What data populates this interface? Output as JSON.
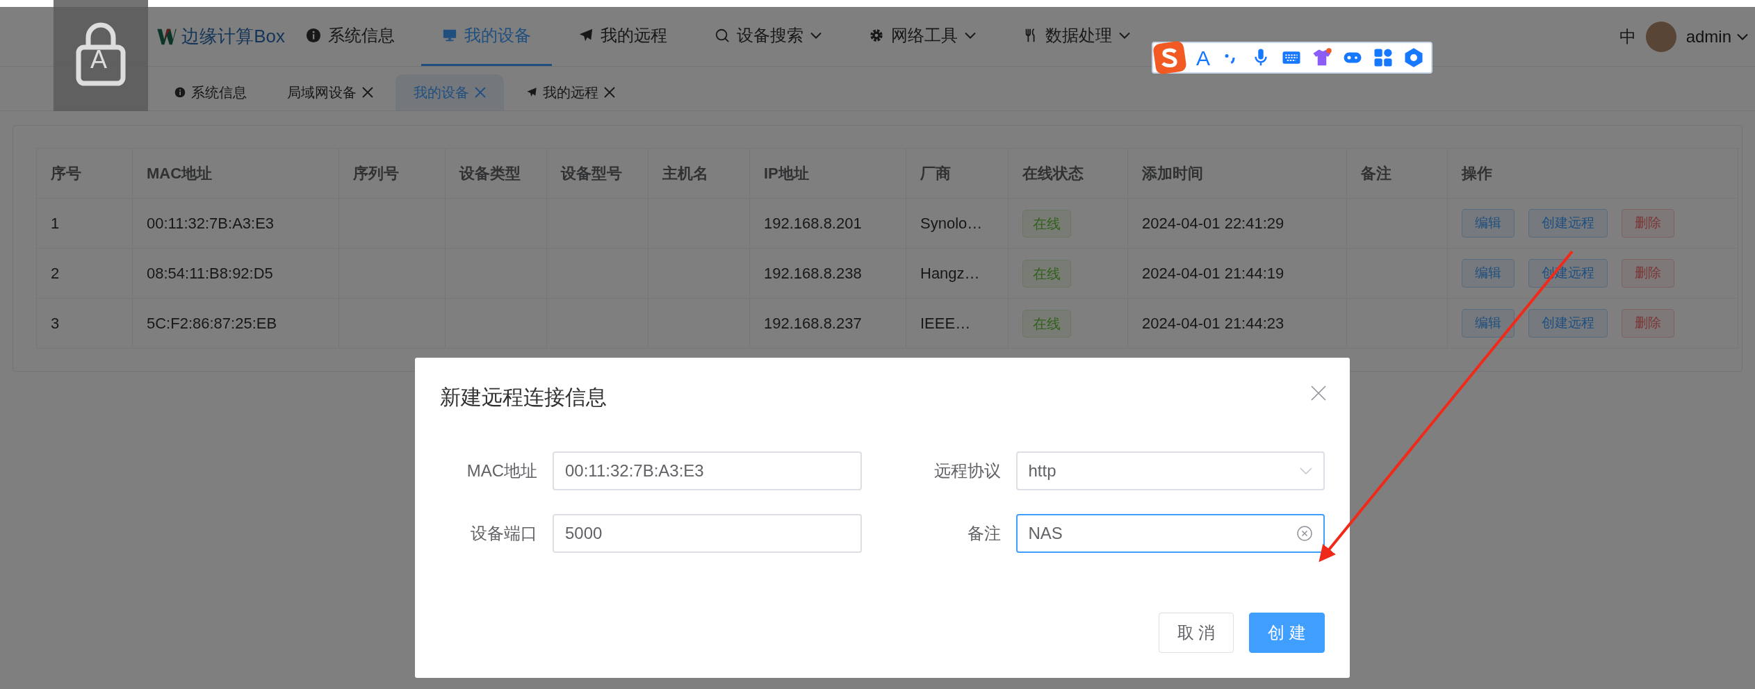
{
  "caps_lock_overlay": {
    "letter": "A"
  },
  "header": {
    "logo": "边缘计算Box",
    "nav": [
      {
        "label": "系统信息",
        "dropdown": false,
        "selected": false
      },
      {
        "label": "我的设备",
        "dropdown": false,
        "selected": true
      },
      {
        "label": "我的远程",
        "dropdown": false,
        "selected": false
      },
      {
        "label": "设备搜索",
        "dropdown": true,
        "selected": false
      },
      {
        "label": "网络工具",
        "dropdown": true,
        "selected": false
      },
      {
        "label": "数据处理",
        "dropdown": true,
        "selected": false
      }
    ],
    "language": "中",
    "user": "admin"
  },
  "ime_toolbar": {
    "mode": "A"
  },
  "tabs": [
    {
      "label": "系统信息",
      "closable": false,
      "selected": false
    },
    {
      "label": "局域网设备",
      "closable": true,
      "selected": false
    },
    {
      "label": "我的设备",
      "closable": true,
      "selected": true
    },
    {
      "label": "我的远程",
      "closable": true,
      "selected": false
    }
  ],
  "table": {
    "columns": [
      "序号",
      "MAC地址",
      "序列号",
      "设备类型",
      "设备型号",
      "主机名",
      "IP地址",
      "厂商",
      "在线状态",
      "添加时间",
      "备注",
      "操作"
    ],
    "rows": [
      {
        "index": "1",
        "mac": "00:11:32:7B:A3:E3",
        "ip": "192.168.8.201",
        "vendor": "Synolo…",
        "status": "在线",
        "online": true,
        "added": "2024-04-01 22:41:29",
        "actions": [
          "编辑",
          "创建远程",
          "删除"
        ]
      },
      {
        "index": "2",
        "mac": "08:54:11:B8:92:D5",
        "ip": "192.168.8.238",
        "vendor": "Hangz…",
        "status": "在线",
        "online": true,
        "added": "2024-04-01 21:44:19",
        "actions": [
          "编辑",
          "创建远程",
          "删除"
        ]
      },
      {
        "index": "3",
        "mac": "5C:F2:86:87:25:EB",
        "ip": "192.168.8.237",
        "vendor": "IEEE…",
        "status": "在线",
        "online": true,
        "added": "2024-04-01 21:44:23",
        "actions": [
          "编辑",
          "创建远程",
          "删除"
        ]
      }
    ]
  },
  "dialog": {
    "title": "新建远程连接信息",
    "fields": [
      {
        "label": "MAC地址",
        "value": "00:11:32:7B:A3:E3",
        "kind": "text",
        "focused": false
      },
      {
        "label": "远程协议",
        "value": "http",
        "kind": "select",
        "focused": false
      },
      {
        "label": "设备端口",
        "value": "5000",
        "kind": "text",
        "focused": false
      },
      {
        "label": "备注",
        "value": "NAS",
        "kind": "clearable",
        "focused": true
      }
    ],
    "buttons": [
      {
        "label": "取 消",
        "kind": "default"
      },
      {
        "label": "创 建",
        "kind": "primary"
      }
    ]
  }
}
